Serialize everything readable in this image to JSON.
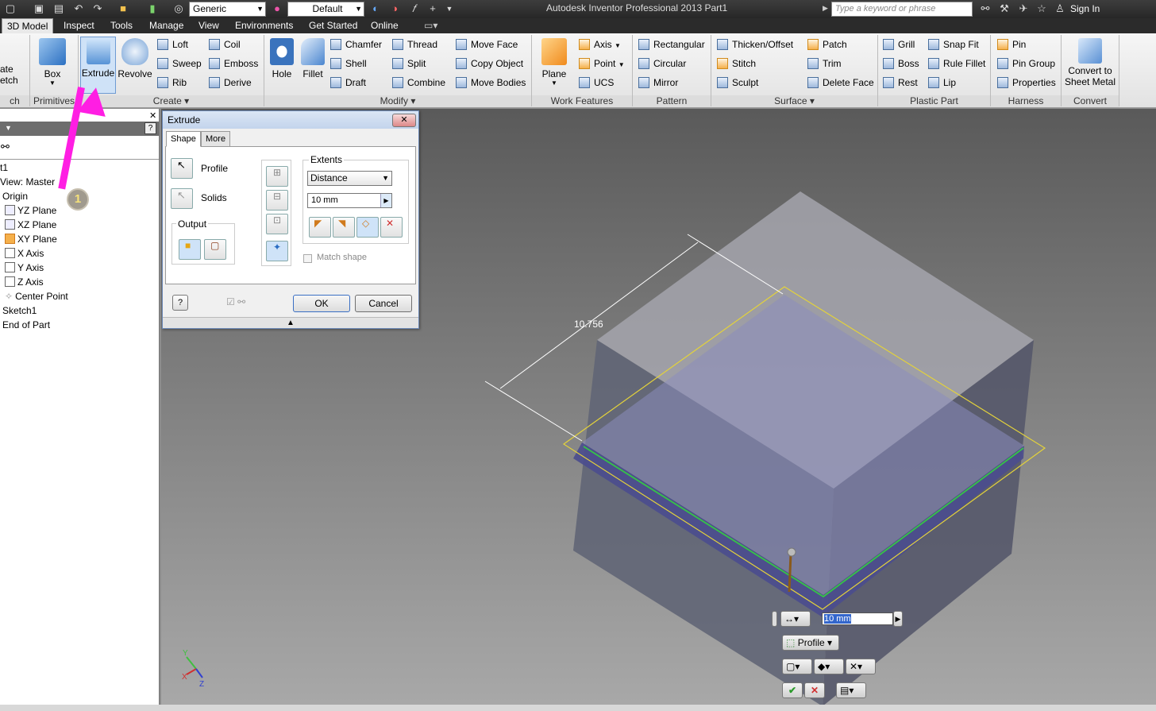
{
  "titlebar": {
    "app_title": "Autodesk Inventor Professional 2013    Part1",
    "material": "Generic",
    "appearance": "Default",
    "search_placeholder": "Type a keyword or phrase",
    "sign_in": "Sign In"
  },
  "tabs": [
    "3D Model",
    "Inspect",
    "Tools",
    "Manage",
    "View",
    "Environments",
    "Get Started",
    "Online"
  ],
  "ribbon": {
    "sketch_partial": [
      "ate",
      "etch"
    ],
    "sketch_label": "ch",
    "primitives": {
      "box": "Box",
      "label": "Primitives"
    },
    "create": {
      "extrude": "Extrude",
      "revolve": "Revolve",
      "loft": "Loft",
      "sweep": "Sweep",
      "rib": "Rib",
      "coil": "Coil",
      "emboss": "Emboss",
      "derive": "Derive",
      "label": "Create"
    },
    "modify": {
      "hole": "Hole",
      "fillet": "Fillet",
      "chamfer": "Chamfer",
      "shell": "Shell",
      "draft": "Draft",
      "thread": "Thread",
      "split": "Split",
      "combine": "Combine",
      "move_face": "Move Face",
      "copy_object": "Copy Object",
      "move_bodies": "Move Bodies",
      "label": "Modify"
    },
    "work_features": {
      "plane": "Plane",
      "axis": "Axis",
      "point": "Point",
      "ucs": "UCS",
      "label": "Work Features"
    },
    "pattern": {
      "rectangular": "Rectangular",
      "circular": "Circular",
      "mirror": "Mirror",
      "label": "Pattern"
    },
    "surface": {
      "thicken": "Thicken/Offset",
      "stitch": "Stitch",
      "sculpt": "Sculpt",
      "patch": "Patch",
      "trim": "Trim",
      "delete_face": "Delete Face",
      "label": "Surface"
    },
    "plastic_part": {
      "grill": "Grill",
      "boss": "Boss",
      "rest": "Rest",
      "snap_fit": "Snap Fit",
      "rule_fillet": "Rule Fillet",
      "lip": "Lip",
      "label": "Plastic Part"
    },
    "harness": {
      "pin": "Pin",
      "pin_group": "Pin Group",
      "properties": "Properties",
      "label": "Harness"
    },
    "convert": {
      "line1": "Convert to",
      "line2": "Sheet Metal",
      "label": "Convert"
    }
  },
  "browser": {
    "items": [
      "t1",
      "View: Master",
      "Origin",
      "YZ Plane",
      "XZ Plane",
      "XY Plane",
      "X Axis",
      "Y Axis",
      "Z Axis",
      "Center Point",
      "Sketch1",
      "End of Part"
    ]
  },
  "dialog": {
    "title": "Extrude",
    "tab_shape": "Shape",
    "tab_more": "More",
    "profile": "Profile",
    "solids": "Solids",
    "output": "Output",
    "extents": "Extents",
    "extent_type": "Distance",
    "distance": "10 mm",
    "match_shape": "Match shape",
    "ok": "OK",
    "cancel": "Cancel"
  },
  "viewport": {
    "dimension": "10.756",
    "mini_value": "10 mm",
    "mini_profile": "Profile",
    "callout_number": "1",
    "callout_color": "#ff1ee3"
  }
}
